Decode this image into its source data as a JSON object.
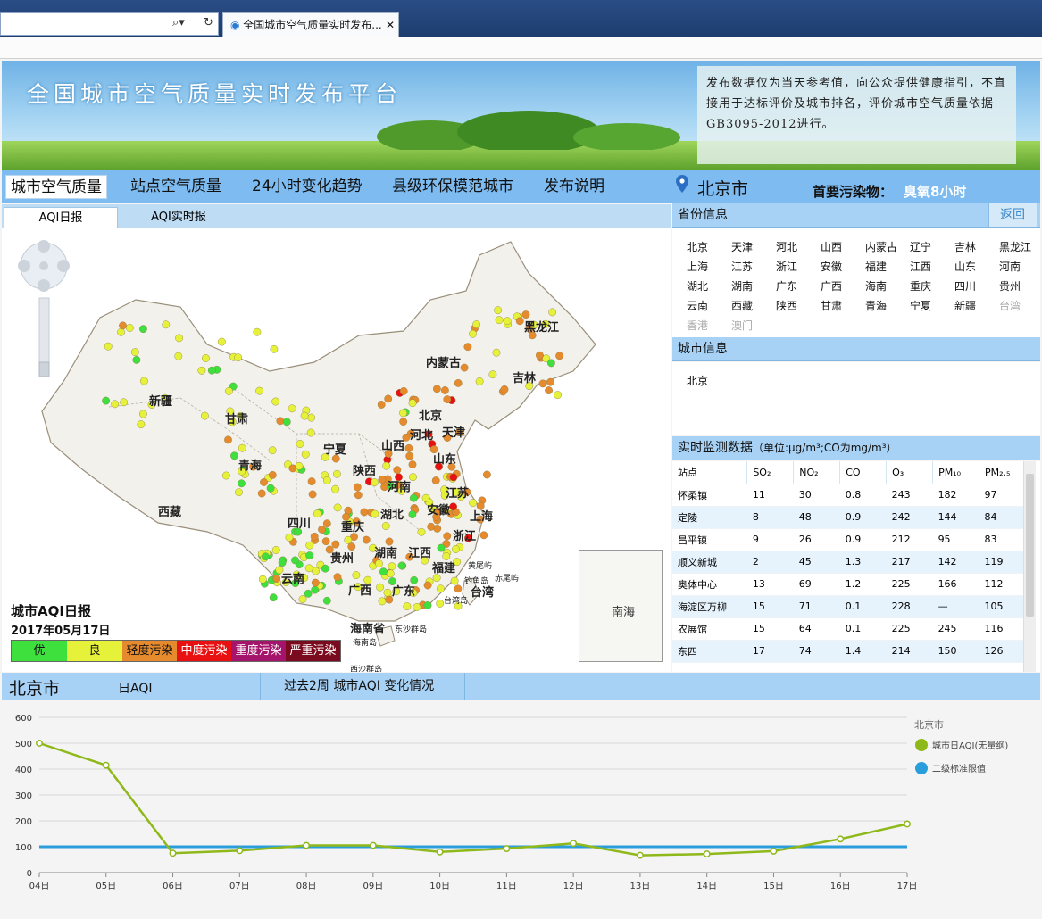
{
  "browser": {
    "tab_title": "全国城市空气质量实时发布..."
  },
  "banner": {
    "title": "全国城市空气质量实时发布平台",
    "notice": "发布数据仅为当天参考值，向公众提供健康指引，不直接用于达标评价及城市排名，评价城市空气质量依据GB3095-2012进行。"
  },
  "nav": {
    "items": [
      "城市空气质量",
      "站点空气质量",
      "24小时变化趋势",
      "县级环保模范城市",
      "发布说明"
    ],
    "city": "北京市",
    "pollutant_label": "首要污染物：",
    "pollutant_value": "臭氧8小时"
  },
  "map": {
    "tabs": [
      "AQI日报",
      "AQI实时报"
    ],
    "legend_title": "城市AQI日报",
    "legend_date": "2017年05月17日",
    "legend": [
      {
        "label": "优",
        "color": "#3ee03e"
      },
      {
        "label": "良",
        "color": "#e6f23a"
      },
      {
        "label": "轻度污染",
        "color": "#e68a2e"
      },
      {
        "label": "中度污染",
        "color": "#e81010"
      },
      {
        "label": "重度污染",
        "color": "#a3146a"
      },
      {
        "label": "严重污染",
        "color": "#7a0a1e"
      }
    ],
    "regions": [
      "黑龙江",
      "内蒙古",
      "吉林",
      "新疆",
      "甘肃",
      "北京",
      "天津",
      "宁夏",
      "山西",
      "河北",
      "青海",
      "陕西",
      "山东",
      "河南",
      "西藏",
      "四川",
      "重庆",
      "江苏",
      "安徽",
      "湖北",
      "上海",
      "贵州",
      "湖南",
      "江西",
      "浙江",
      "福建",
      "云南",
      "广西",
      "广东",
      "台湾",
      "海南省",
      "黄尾屿",
      "赤尾屿",
      "钓鱼岛",
      "台湾岛",
      "东沙群岛",
      "海南岛",
      "西沙群岛"
    ],
    "inset_label": "南海"
  },
  "province": {
    "title": "省份信息",
    "back": "返回",
    "list": [
      "北京",
      "天津",
      "河北",
      "山西",
      "内蒙古",
      "辽宁",
      "吉林",
      "黑龙江",
      "上海",
      "江苏",
      "浙江",
      "安徽",
      "福建",
      "江西",
      "山东",
      "河南",
      "湖北",
      "湖南",
      "广东",
      "广西",
      "海南",
      "重庆",
      "四川",
      "贵州",
      "云南",
      "西藏",
      "陕西",
      "甘肃",
      "青海",
      "宁夏",
      "新疆",
      "台湾",
      "香港",
      "澳门"
    ]
  },
  "city_info": {
    "title": "城市信息",
    "city": "北京"
  },
  "monitor": {
    "title": "实时监测数据",
    "unit": "（单位:μg/m³;CO为mg/m³）",
    "headers": [
      "站点",
      "SO₂",
      "NO₂",
      "CO",
      "O₃",
      "PM₁₀",
      "PM₂.₅"
    ],
    "rows": [
      [
        "怀柔镇",
        "11",
        "30",
        "0.8",
        "243",
        "182",
        "97"
      ],
      [
        "定陵",
        "8",
        "48",
        "0.9",
        "242",
        "144",
        "84"
      ],
      [
        "昌平镇",
        "9",
        "26",
        "0.9",
        "212",
        "95",
        "83"
      ],
      [
        "顺义新城",
        "2",
        "45",
        "1.3",
        "217",
        "142",
        "119"
      ],
      [
        "奥体中心",
        "13",
        "69",
        "1.2",
        "225",
        "166",
        "112"
      ],
      [
        "海淀区万柳",
        "15",
        "71",
        "0.1",
        "228",
        "—",
        "105"
      ],
      [
        "农展馆",
        "15",
        "64",
        "0.1",
        "225",
        "245",
        "116"
      ],
      [
        "东四",
        "17",
        "74",
        "1.4",
        "214",
        "150",
        "126"
      ]
    ]
  },
  "chart_section": {
    "city": "北京市",
    "tab1": "日AQI",
    "tab2": "过去2周 城市AQI 变化情况"
  },
  "chart_data": {
    "type": "line",
    "x": [
      "04日",
      "05日",
      "06日",
      "07日",
      "08日",
      "09日",
      "10日",
      "11日",
      "12日",
      "13日",
      "14日",
      "15日",
      "16日",
      "17日"
    ],
    "ylim": [
      0,
      600
    ],
    "yticks": [
      0,
      100,
      200,
      300,
      400,
      500,
      600
    ],
    "legend_title": "北京市",
    "series": [
      {
        "name": "城市日AQI(无量纲)",
        "color": "#8fb81a",
        "values": [
          500,
          415,
          75,
          85,
          105,
          105,
          80,
          93,
          113,
          67,
          72,
          83,
          130,
          188
        ]
      },
      {
        "name": "二级标准限值",
        "color": "#2a9ddb",
        "values": [
          100,
          100,
          100,
          100,
          100,
          100,
          100,
          100,
          100,
          100,
          100,
          100,
          100,
          100
        ]
      }
    ]
  }
}
